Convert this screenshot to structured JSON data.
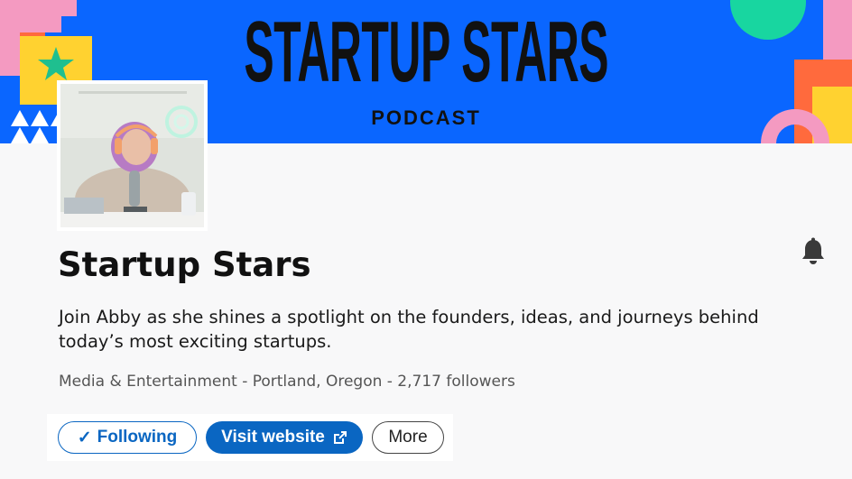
{
  "banner": {
    "title": "STARTUP STARS",
    "subtitle": "PODCAST",
    "background_color": "#0a66ff"
  },
  "profile": {
    "name": "Startup Stars",
    "tagline": "Join Abby as she shines a spotlight on the founders, ideas, and journeys behind today’s most exciting startups.",
    "meta": "Media & Entertainment - Portland, Oregon - 2,717 followers",
    "avatar_icon": "podcast-host-photo",
    "notification_icon": "bell-icon"
  },
  "actions": {
    "following_label": "Following",
    "following_icon": "check-icon",
    "visit_label": "Visit website",
    "visit_icon": "external-link-icon",
    "more_label": "More",
    "accent_color": "#0a66c2"
  }
}
